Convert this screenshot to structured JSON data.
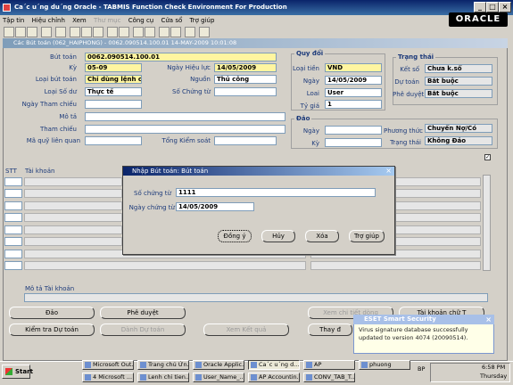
{
  "window": {
    "title": "Ca´c u´ng du´ng Oracle - TABMIS Function Check Environment For Production"
  },
  "menu": [
    {
      "label": "Tập tin",
      "enabled": true
    },
    {
      "label": "Hiệu chỉnh",
      "enabled": true
    },
    {
      "label": "Xem",
      "enabled": true
    },
    {
      "label": "Thư mục",
      "enabled": false
    },
    {
      "label": "Công cụ",
      "enabled": true
    },
    {
      "label": "Cửa sổ",
      "enabled": true
    },
    {
      "label": "Trợ giúp",
      "enabled": true
    }
  ],
  "logo": "ORACLE",
  "form": {
    "title": "Các Bút toán (062_HAIPHONG) - 0062.090514.100.01 14-MAY-2009 10:01:08",
    "but_toan_label": "Bút toán",
    "but_toan": "0062.090514.100.01",
    "ky_label": "Kỳ",
    "ky": "05-09",
    "ngay_hieu_luc_label": "Ngày Hiệu lực",
    "ngay_hieu_luc": "14/05/2009",
    "loai_but_toan_label": "Loại bút toán",
    "loai_but_toan": "Chỉ dùng lệnh chỉ",
    "nguon_label": "Nguồn",
    "nguon": "Thủ công",
    "loai_so_du_label": "Loại Số dư",
    "loai_so_du": "Thực tế",
    "so_chung_tu_label": "Số Chứng từ",
    "ngay_tham_chieu_label": "Ngày Tham chiếu",
    "mo_ta_label": "Mô tả",
    "tham_chieu_label": "Tham chiếu",
    "ma_quy_label": "Mã quỹ liên quan",
    "tong_kiem_soat_label": "Tổng Kiểm soát"
  },
  "quy_doi": {
    "title": "Quy đổi",
    "loai_tien_label": "Loại tiền",
    "loai_tien": "VND",
    "ngay_label": "Ngày",
    "ngay": "14/05/2009",
    "loai_label": "Loai",
    "loai": "User",
    "ty_gia_label": "Tỷ giá",
    "ty_gia": "1"
  },
  "trang_thai": {
    "title": "Trạng thái",
    "ket_so_label": "Kết số",
    "ket_so": "Chưa k.sổ",
    "du_toan_label": "Dự toán",
    "du_toan": "Bắt buộc",
    "phe_duyet_label": "Phê duyệt",
    "phe_duyet": "Bắt buộc"
  },
  "dao": {
    "title": "Đảo",
    "ngay_label": "Ngày",
    "ky_label": "Kỳ",
    "phuong_thuc_label": "Phương thức",
    "phuong_thuc": "Chuyển Nợ/Có",
    "trang_thai_label": "Trạng thái",
    "trang_thai": "Không Đảo"
  },
  "lines": {
    "stt_header": "STT",
    "tai_khoan_header": "Tài khoản",
    "mo_ta_tai_khoan_label": "Mô tả Tài khoản"
  },
  "buttons": {
    "dao": "Đảo",
    "phe_duyet": "Phê duyệt",
    "xem_chi_tiet": "Xem chi tiết dòng",
    "tai_khoan_chu_t": "Tài khoản chữ T",
    "kiem_tra_du_toan": "Kiểm tra Dự toán",
    "danh_du_toan": "Dành Dự toán",
    "xem_ket_qua": "Xem Kết quả",
    "thay_doi": "Thay đ"
  },
  "modal": {
    "title": "Nhập Bút toán: Bút toán",
    "so_chung_tu_label": "Số chứng từ",
    "so_chung_tu": "1111",
    "ngay_chung_tu_label": "Ngày chứng từ",
    "ngay_chung_tu": "14/05/2009",
    "ok": "Đồng ý",
    "cancel": "Hủy",
    "delete": "Xóa",
    "help": "Trợ giúp"
  },
  "eset": {
    "title": "ESET Smart Security",
    "message": "Virus signature database successfully updated to version 4074 (20090514)."
  },
  "taskbar": {
    "start": "Start",
    "row1": [
      "Microsoft Out...",
      "Trang chủ Ứn...",
      "Oracle Applic...",
      "Ca´c u´ng d...",
      "AP",
      "phuong"
    ],
    "row2": [
      "4 Microsoft ...",
      "Lenh chi tien...",
      "User_Name_...",
      "AP Accountin...",
      "CONV_TAB_T..."
    ],
    "lang": "BP",
    "time": "6:58 PM",
    "day": "Thursday"
  }
}
